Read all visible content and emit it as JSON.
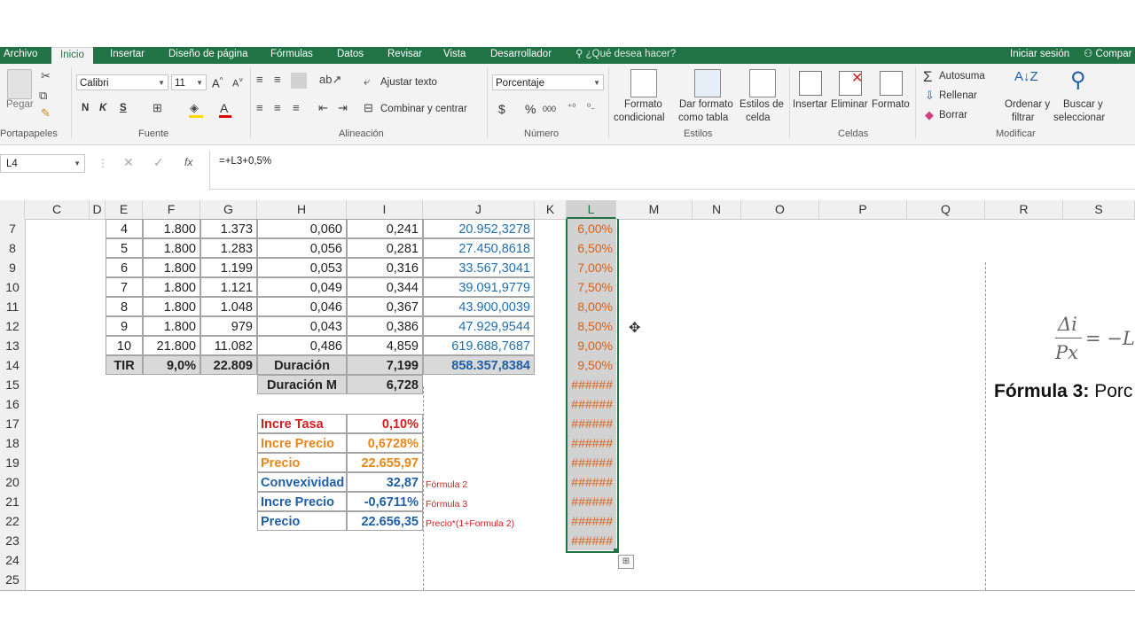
{
  "tabs": [
    "Archivo",
    "Inicio",
    "Insertar",
    "Diseño de página",
    "Fórmulas",
    "Datos",
    "Revisar",
    "Vista",
    "Desarrollador"
  ],
  "tell_me": "¿Qué desea hacer?",
  "sign_in": "Iniciar sesión",
  "share": "Compar",
  "ribbon": {
    "paste": "Pegar",
    "font_name": "Calibri",
    "font_size": "11",
    "bold": "N",
    "italic": "K",
    "underline": "S",
    "wrap_text": "Ajustar texto",
    "merge_center": "Combinar y centrar",
    "number_format": "Porcentaje",
    "currency": "$",
    "percent": "%",
    "thousands": "000",
    "cond_format_1": "Formato",
    "cond_format_2": "condicional",
    "format_table_1": "Dar formato",
    "format_table_2": "como tabla",
    "cell_styles_1": "Estilos de",
    "cell_styles_2": "celda",
    "insert": "Insertar",
    "delete": "Eliminar",
    "format": "Formato",
    "autosum": "Autosuma",
    "fill": "Rellenar",
    "clear": "Borrar",
    "sort_1": "Ordenar y",
    "sort_2": "filtrar",
    "find_1": "Buscar y",
    "find_2": "seleccionar",
    "groups": {
      "clipboard": "Portapapeles",
      "font": "Fuente",
      "alignment": "Alineación",
      "number": "Número",
      "styles": "Estilos",
      "cells": "Celdas",
      "editing": "Modificar"
    }
  },
  "formula_bar": {
    "name_box": "L4",
    "fx": "fx",
    "formula": "=+L3+0,5%"
  },
  "columns": [
    "C",
    "D",
    "E",
    "F",
    "G",
    "H",
    "I",
    "J",
    "K",
    "L",
    "M",
    "N",
    "O",
    "P",
    "Q",
    "R",
    "S"
  ],
  "rows": [
    "7",
    "8",
    "9",
    "10",
    "11",
    "12",
    "13",
    "14",
    "15",
    "16",
    "17",
    "18",
    "19",
    "20",
    "21",
    "22",
    "23",
    "24",
    "25"
  ],
  "table": [
    {
      "e": "4",
      "f": "1.800",
      "g": "1.373",
      "h": "0,060",
      "i": "0,241",
      "j": "20.952,3278"
    },
    {
      "e": "5",
      "f": "1.800",
      "g": "1.283",
      "h": "0,056",
      "i": "0,281",
      "j": "27.450,8618"
    },
    {
      "e": "6",
      "f": "1.800",
      "g": "1.199",
      "h": "0,053",
      "i": "0,316",
      "j": "33.567,3041"
    },
    {
      "e": "7",
      "f": "1.800",
      "g": "1.121",
      "h": "0,049",
      "i": "0,344",
      "j": "39.091,9779"
    },
    {
      "e": "8",
      "f": "1.800",
      "g": "1.048",
      "h": "0,046",
      "i": "0,367",
      "j": "43.900,0039"
    },
    {
      "e": "9",
      "f": "1.800",
      "g": "979",
      "h": "0,043",
      "i": "0,386",
      "j": "47.929,9544"
    },
    {
      "e": "10",
      "f": "21.800",
      "g": "11.082",
      "h": "0,486",
      "i": "4,859",
      "j": "619.688,7687"
    }
  ],
  "summary": {
    "tir_label": "TIR",
    "tir": "9,0%",
    "g_total": "22.809",
    "dur_label": "Duración",
    "dur": "7,199",
    "j_total": "858.357,8384"
  },
  "duracion_m": {
    "label": "Duración M",
    "value": "6,728"
  },
  "calc": [
    {
      "label": "Incre Tasa",
      "value": "0,10%",
      "note": ""
    },
    {
      "label": "Incre Precio",
      "value": "0,6728%",
      "note": ""
    },
    {
      "label": "Precio",
      "value": "22.655,97",
      "note": ""
    },
    {
      "label": "Convexividad",
      "value": "32,87",
      "note": "Fórmula 2"
    },
    {
      "label": "Incre Precio",
      "value": "-0,6711%",
      "note": "Fórmula 3"
    },
    {
      "label": "Precio",
      "value": "22.656,35",
      "note": "Precio*(1+Formula 2)"
    }
  ],
  "col_l": [
    "6,00%",
    "6,50%",
    "7,00%",
    "7,50%",
    "8,00%",
    "8,50%",
    "9,00%",
    "9,50%",
    "######",
    "######",
    "######",
    "######",
    "######",
    "######",
    "######",
    "######",
    "######"
  ],
  "equation_fragment": {
    "num": "Δi",
    "den": "Px",
    "rhs": "= −L"
  },
  "formula3": {
    "bold": "Fórmula 3:",
    "rest": " Porc"
  },
  "colors": {
    "excel_green": "#217346",
    "blue": "#1f6fb0",
    "red": "#d02020",
    "orange": "#e8861a",
    "l_text": "#d4611a"
  }
}
